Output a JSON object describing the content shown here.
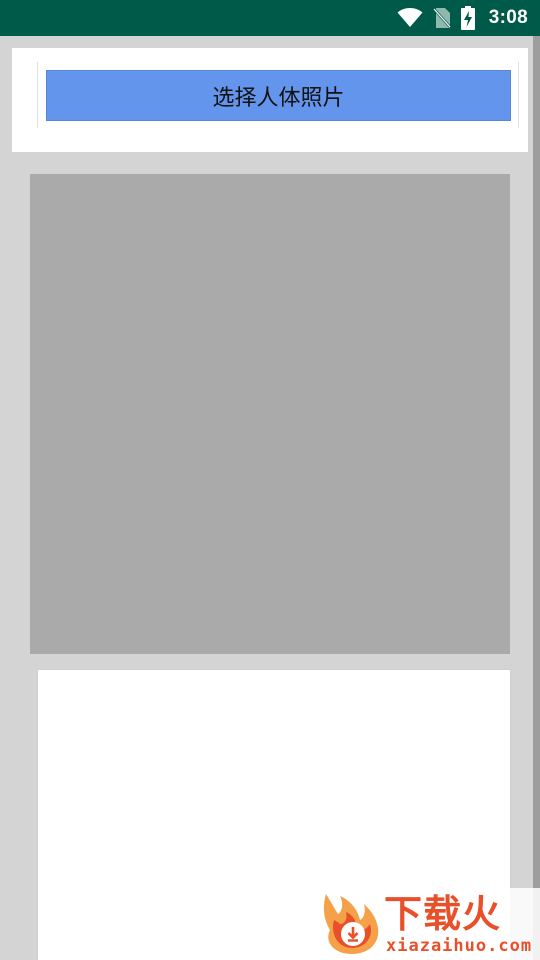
{
  "status_bar": {
    "time": "3:08",
    "icons": [
      "wifi-icon",
      "no-sim-icon",
      "battery-charging-icon"
    ],
    "background": "#005a4a"
  },
  "main": {
    "pick_button_label": "选择人体照片",
    "pick_button_color": "#6495ed",
    "image_placeholder_color": "#aaaaaa"
  },
  "watermark": {
    "title": "下载火",
    "url": "xiazaihuo.com"
  }
}
